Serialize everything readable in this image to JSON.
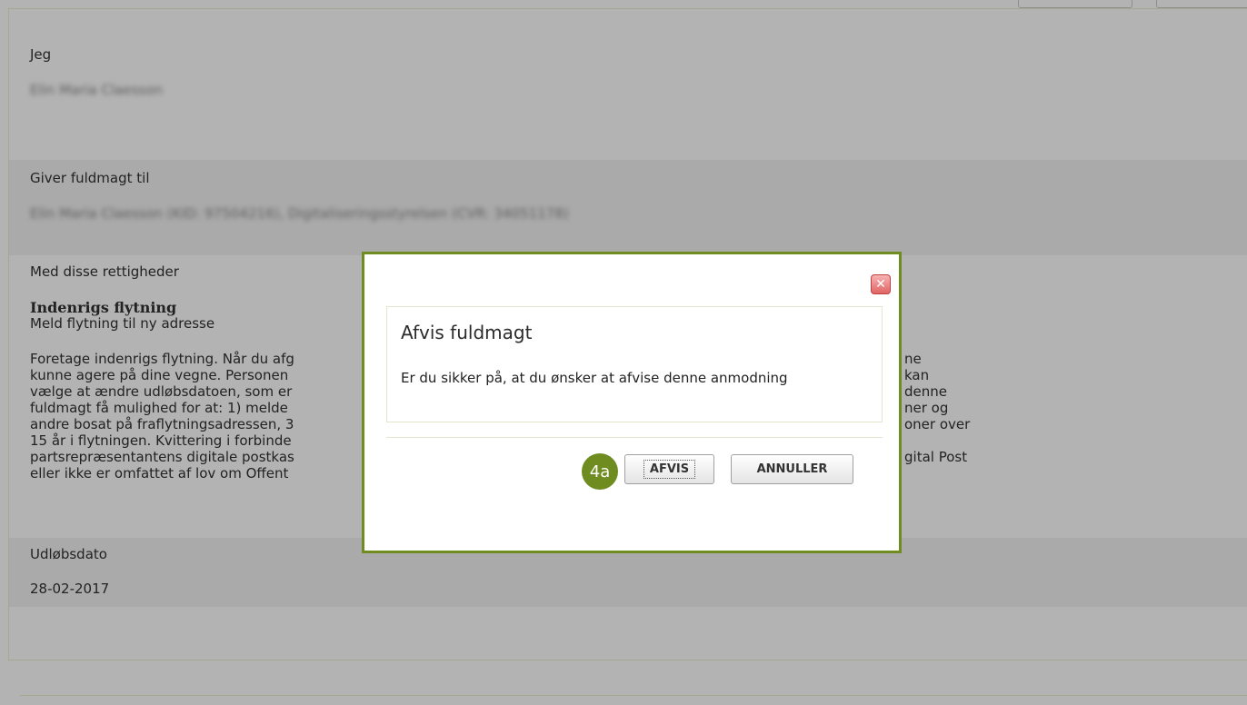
{
  "sections": {
    "me_label": "Jeg",
    "me_value": "Elin Maria Claesson",
    "giver_label": "Giver fuldmagt til",
    "giver_value": "Elin Maria Claesson (KID: 97504216), Digitaliseringsstyrelsen (CVR: 34051178)",
    "rights_label": "Med disse rettigheder",
    "right_title": "Indenrigs flytning",
    "right_subtitle": "Meld flytning til ny adresse",
    "body_lines": [
      "Foretage indenrigs flytning. Når du afg",
      "kunne agere på dine vegne. Personen",
      "vælge at ændre udløbsdatoen, som er",
      "fuldmagt få mulighed for at: 1) melde",
      "andre bosat på fraflytningsadressen, 3",
      "15 år i flytningen. Kvittering i forbinde",
      "partsrepræsentantens digitale postkas",
      "eller ikke er omfattet af lov om Offent"
    ],
    "body_right_lines": [
      "ne",
      "kan",
      "denne",
      "ner og",
      "oner over",
      "",
      "gital Post",
      ""
    ],
    "expiry_label": "Udløbsdato",
    "expiry_value": "28-02-2017"
  },
  "modal": {
    "title": "Afvis fuldmagt",
    "message": "Er du sikker på, at du ønsker at afvise denne anmodning",
    "badge": "4a",
    "confirm_label": "AFVIS",
    "cancel_label": "ANNULLER",
    "close_glyph": "✕"
  },
  "colors": {
    "accent": "#6e8c1f",
    "overlay": "#b3b3b3",
    "close": "#e06464"
  }
}
